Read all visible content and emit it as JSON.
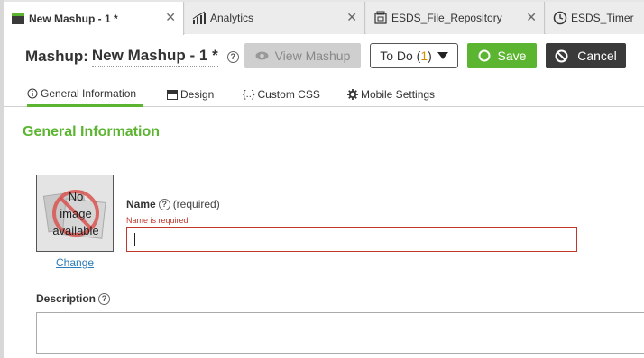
{
  "tabs": [
    {
      "label": "New Mashup - 1 *",
      "icon": "mashup-icon",
      "close": "✕"
    },
    {
      "label": "Analytics",
      "icon": "analytics-icon",
      "close": "✕"
    },
    {
      "label": "ESDS_File_Repository",
      "icon": "repository-icon",
      "close": "✕"
    },
    {
      "label": "ESDS_Timer",
      "icon": "timer-icon"
    }
  ],
  "header": {
    "prefix": "Mashup:",
    "name": "New Mashup - 1 *",
    "help": "?"
  },
  "toolbar": {
    "view_label": "View Mashup",
    "todo_label": "To Do (",
    "todo_count": "1",
    "todo_close": ")",
    "save_label": "Save",
    "cancel_label": "Cancel"
  },
  "subtabs": {
    "general": "General Information",
    "design": "Design",
    "css": "Custom CSS",
    "mobile": "Mobile Settings"
  },
  "section": {
    "title": "General Information"
  },
  "image": {
    "placeholder_line1": "No",
    "placeholder_line2": "image",
    "placeholder_line3": "available",
    "change_label": "Change"
  },
  "name_field": {
    "label": "Name",
    "required": "(required)",
    "error": "Name is required",
    "value": ""
  },
  "description_field": {
    "label": "Description"
  },
  "colors": {
    "accent_green": "#5cb531",
    "error_red": "#c0392b",
    "link_blue": "#2d7bb8",
    "dark_button": "#3a3a3a"
  }
}
